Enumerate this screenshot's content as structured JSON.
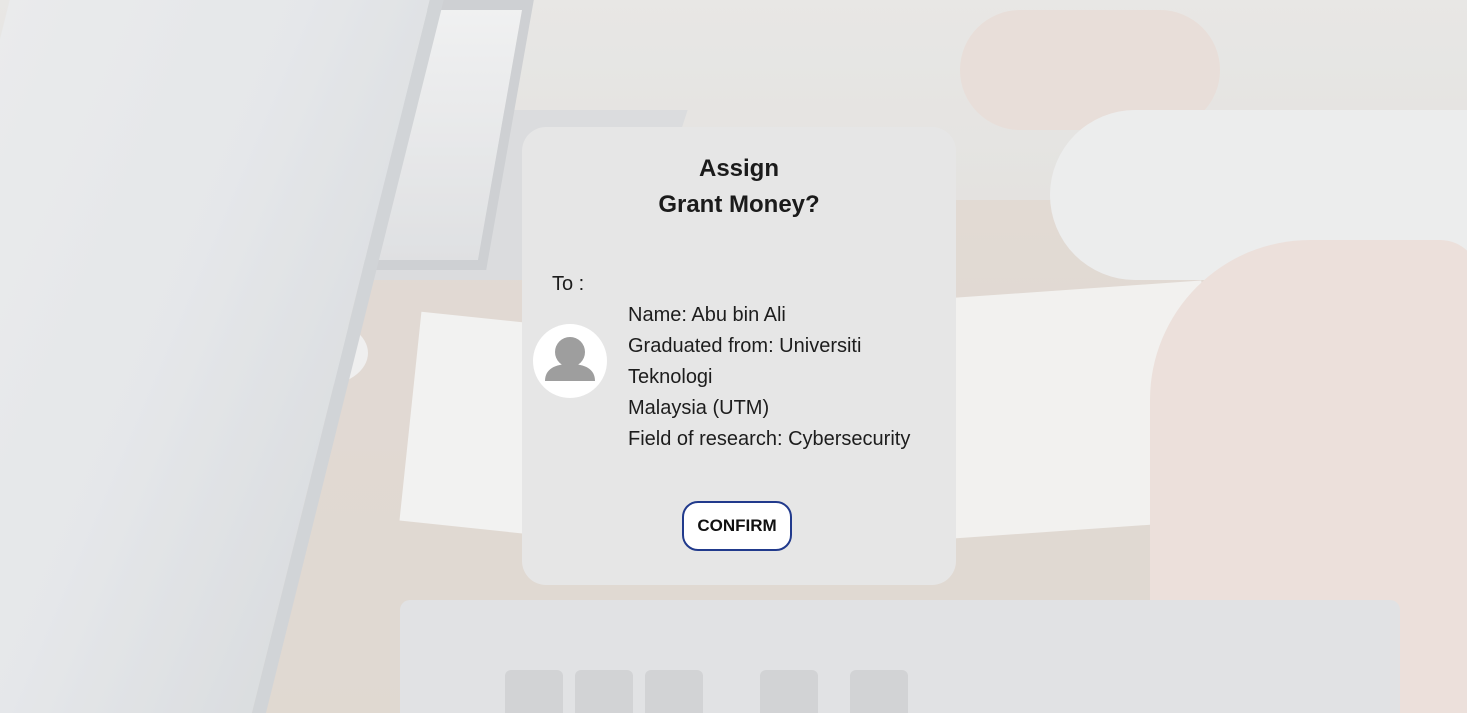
{
  "dialog": {
    "title_line1": "Assign",
    "title_line2": "Grant Money?",
    "to_label": "To :",
    "recipient": {
      "name_line": "Name: Abu bin Ali",
      "graduated_line1": "Graduated from: Universiti",
      "graduated_line2": "Teknologi",
      "graduated_line3": "Malaysia (UTM)",
      "field_line": "Field of research: Cybersecurity",
      "avatar_icon": "user-avatar-icon"
    },
    "confirm_label": "CONFIRM"
  },
  "colors": {
    "dialog_background": "#e6e6e6",
    "button_border": "#213a8c",
    "button_background": "#ffffff",
    "text": "#1d1d1d"
  }
}
